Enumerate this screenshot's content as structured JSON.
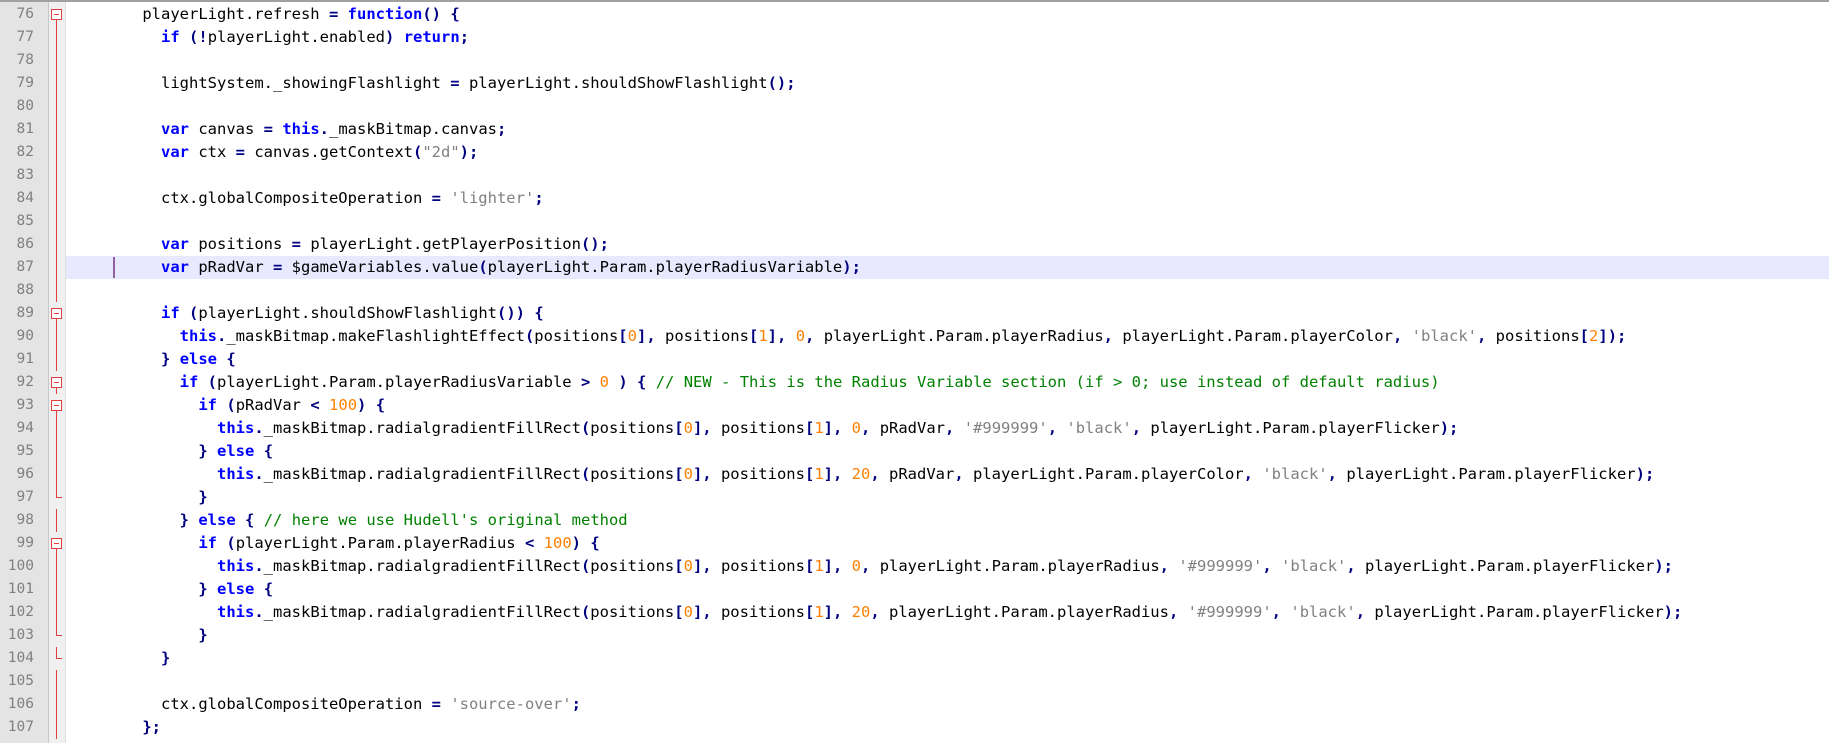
{
  "editor": {
    "current_line": 87,
    "colors": {
      "keyword": "#0000ff",
      "number": "#ff8000",
      "string": "#808080",
      "comment": "#008000",
      "operator": "#000080",
      "current_line_bg": "#e8e8ff",
      "gutter_bg": "#e4e4e4",
      "fold_marker": "#e04040"
    },
    "lines": [
      {
        "n": "76",
        "fold": "open",
        "indent": 2,
        "tokens": [
          [
            "id",
            "playerLight.refresh "
          ],
          [
            "op",
            "="
          ],
          [
            "id",
            " "
          ],
          [
            "kw",
            "function"
          ],
          [
            "op",
            "()"
          ],
          [
            "id",
            " "
          ],
          [
            "op",
            "{"
          ]
        ]
      },
      {
        "n": "77",
        "fold": "line",
        "indent": 3,
        "tokens": [
          [
            "kw",
            "if"
          ],
          [
            "id",
            " "
          ],
          [
            "op",
            "(!"
          ],
          [
            "id",
            "playerLight.enabled"
          ],
          [
            "op",
            ")"
          ],
          [
            "id",
            " "
          ],
          [
            "kw",
            "return"
          ],
          [
            "op",
            ";"
          ]
        ]
      },
      {
        "n": "78",
        "fold": "line",
        "indent": 0,
        "tokens": []
      },
      {
        "n": "79",
        "fold": "line",
        "indent": 3,
        "tokens": [
          [
            "id",
            "lightSystem._showingFlashlight "
          ],
          [
            "op",
            "="
          ],
          [
            "id",
            " playerLight.shouldShowFlashlight"
          ],
          [
            "op",
            "();"
          ]
        ]
      },
      {
        "n": "80",
        "fold": "line",
        "indent": 0,
        "tokens": []
      },
      {
        "n": "81",
        "fold": "line",
        "indent": 3,
        "tokens": [
          [
            "kw",
            "var"
          ],
          [
            "id",
            " canvas "
          ],
          [
            "op",
            "="
          ],
          [
            "id",
            " "
          ],
          [
            "kw",
            "this"
          ],
          [
            "op",
            "."
          ],
          [
            "id",
            "_maskBitmap.canvas"
          ],
          [
            "op",
            ";"
          ]
        ]
      },
      {
        "n": "82",
        "fold": "line",
        "indent": 3,
        "tokens": [
          [
            "kw",
            "var"
          ],
          [
            "id",
            " ctx "
          ],
          [
            "op",
            "="
          ],
          [
            "id",
            " canvas.getContext"
          ],
          [
            "op",
            "("
          ],
          [
            "str",
            "\"2d\""
          ],
          [
            "op",
            ");"
          ]
        ]
      },
      {
        "n": "83",
        "fold": "line",
        "indent": 0,
        "tokens": []
      },
      {
        "n": "84",
        "fold": "line",
        "indent": 3,
        "tokens": [
          [
            "id",
            "ctx.globalCompositeOperation "
          ],
          [
            "op",
            "="
          ],
          [
            "id",
            " "
          ],
          [
            "str",
            "'lighter'"
          ],
          [
            "op",
            ";"
          ]
        ]
      },
      {
        "n": "85",
        "fold": "line",
        "indent": 0,
        "tokens": []
      },
      {
        "n": "86",
        "fold": "line",
        "indent": 3,
        "tokens": [
          [
            "kw",
            "var"
          ],
          [
            "id",
            " positions "
          ],
          [
            "op",
            "="
          ],
          [
            "id",
            " playerLight.getPlayerPosition"
          ],
          [
            "op",
            "();"
          ]
        ]
      },
      {
        "n": "87",
        "fold": "line",
        "indent": 3,
        "tokens": [
          [
            "kw",
            "var"
          ],
          [
            "id",
            " pRadVar "
          ],
          [
            "op",
            "="
          ],
          [
            "id",
            " $gameVariables.value"
          ],
          [
            "op",
            "("
          ],
          [
            "id",
            "playerLight.Param.playerRadiusVariable"
          ],
          [
            "op",
            ");"
          ]
        ]
      },
      {
        "n": "88",
        "fold": "line",
        "indent": 0,
        "tokens": []
      },
      {
        "n": "89",
        "fold": "open",
        "indent": 3,
        "tokens": [
          [
            "kw",
            "if"
          ],
          [
            "id",
            " "
          ],
          [
            "op",
            "("
          ],
          [
            "id",
            "playerLight.shouldShowFlashlight"
          ],
          [
            "op",
            "())"
          ],
          [
            "id",
            " "
          ],
          [
            "op",
            "{"
          ]
        ]
      },
      {
        "n": "90",
        "fold": "line",
        "indent": 4,
        "tokens": [
          [
            "kw",
            "this"
          ],
          [
            "op",
            "."
          ],
          [
            "id",
            "_maskBitmap.makeFlashlightEffect"
          ],
          [
            "op",
            "("
          ],
          [
            "id",
            "positions"
          ],
          [
            "op",
            "["
          ],
          [
            "num",
            "0"
          ],
          [
            "op",
            "],"
          ],
          [
            "id",
            " positions"
          ],
          [
            "op",
            "["
          ],
          [
            "num",
            "1"
          ],
          [
            "op",
            "],"
          ],
          [
            "id",
            " "
          ],
          [
            "num",
            "0"
          ],
          [
            "op",
            ","
          ],
          [
            "id",
            " playerLight.Param.playerRadius"
          ],
          [
            "op",
            ","
          ],
          [
            "id",
            " playerLight.Param.playerColor"
          ],
          [
            "op",
            ","
          ],
          [
            "id",
            " "
          ],
          [
            "str",
            "'black'"
          ],
          [
            "op",
            ","
          ],
          [
            "id",
            " positions"
          ],
          [
            "op",
            "["
          ],
          [
            "num",
            "2"
          ],
          [
            "op",
            "]);"
          ]
        ]
      },
      {
        "n": "91",
        "fold": "line",
        "indent": 3,
        "tokens": [
          [
            "op",
            "}"
          ],
          [
            "id",
            " "
          ],
          [
            "kw",
            "else"
          ],
          [
            "id",
            " "
          ],
          [
            "op",
            "{"
          ]
        ]
      },
      {
        "n": "92",
        "fold": "open",
        "indent": 4,
        "tokens": [
          [
            "kw",
            "if"
          ],
          [
            "id",
            " "
          ],
          [
            "op",
            "("
          ],
          [
            "id",
            "playerLight.Param.playerRadiusVariable "
          ],
          [
            "op",
            ">"
          ],
          [
            "id",
            " "
          ],
          [
            "num",
            "0"
          ],
          [
            "id",
            " "
          ],
          [
            "op",
            ")"
          ],
          [
            "id",
            " "
          ],
          [
            "op",
            "{"
          ],
          [
            "id",
            " "
          ],
          [
            "cmt",
            "// NEW - This is the Radius Variable section (if > 0; use instead of default radius)"
          ]
        ]
      },
      {
        "n": "93",
        "fold": "open",
        "indent": 5,
        "tokens": [
          [
            "kw",
            "if"
          ],
          [
            "id",
            " "
          ],
          [
            "op",
            "("
          ],
          [
            "id",
            "pRadVar "
          ],
          [
            "op",
            "<"
          ],
          [
            "id",
            " "
          ],
          [
            "num",
            "100"
          ],
          [
            "op",
            ")"
          ],
          [
            "id",
            " "
          ],
          [
            "op",
            "{"
          ]
        ]
      },
      {
        "n": "94",
        "fold": "line",
        "indent": 6,
        "tokens": [
          [
            "kw",
            "this"
          ],
          [
            "op",
            "."
          ],
          [
            "id",
            "_maskBitmap.radialgradientFillRect"
          ],
          [
            "op",
            "("
          ],
          [
            "id",
            "positions"
          ],
          [
            "op",
            "["
          ],
          [
            "num",
            "0"
          ],
          [
            "op",
            "],"
          ],
          [
            "id",
            " positions"
          ],
          [
            "op",
            "["
          ],
          [
            "num",
            "1"
          ],
          [
            "op",
            "],"
          ],
          [
            "id",
            " "
          ],
          [
            "num",
            "0"
          ],
          [
            "op",
            ","
          ],
          [
            "id",
            " pRadVar"
          ],
          [
            "op",
            ","
          ],
          [
            "id",
            " "
          ],
          [
            "str",
            "'#999999'"
          ],
          [
            "op",
            ","
          ],
          [
            "id",
            " "
          ],
          [
            "str",
            "'black'"
          ],
          [
            "op",
            ","
          ],
          [
            "id",
            " playerLight.Param.playerFlicker"
          ],
          [
            "op",
            ");"
          ]
        ]
      },
      {
        "n": "95",
        "fold": "line",
        "indent": 5,
        "tokens": [
          [
            "op",
            "}"
          ],
          [
            "id",
            " "
          ],
          [
            "kw",
            "else"
          ],
          [
            "id",
            " "
          ],
          [
            "op",
            "{"
          ]
        ]
      },
      {
        "n": "96",
        "fold": "line",
        "indent": 6,
        "tokens": [
          [
            "kw",
            "this"
          ],
          [
            "op",
            "."
          ],
          [
            "id",
            "_maskBitmap.radialgradientFillRect"
          ],
          [
            "op",
            "("
          ],
          [
            "id",
            "positions"
          ],
          [
            "op",
            "["
          ],
          [
            "num",
            "0"
          ],
          [
            "op",
            "],"
          ],
          [
            "id",
            " positions"
          ],
          [
            "op",
            "["
          ],
          [
            "num",
            "1"
          ],
          [
            "op",
            "],"
          ],
          [
            "id",
            " "
          ],
          [
            "num",
            "20"
          ],
          [
            "op",
            ","
          ],
          [
            "id",
            " pRadVar"
          ],
          [
            "op",
            ","
          ],
          [
            "id",
            " playerLight.Param.playerColor"
          ],
          [
            "op",
            ","
          ],
          [
            "id",
            " "
          ],
          [
            "str",
            "'black'"
          ],
          [
            "op",
            ","
          ],
          [
            "id",
            " playerLight.Param.playerFlicker"
          ],
          [
            "op",
            ");"
          ]
        ]
      },
      {
        "n": "97",
        "fold": "end",
        "indent": 5,
        "tokens": [
          [
            "op",
            "}"
          ]
        ]
      },
      {
        "n": "98",
        "fold": "line",
        "indent": 4,
        "tokens": [
          [
            "op",
            "}"
          ],
          [
            "id",
            " "
          ],
          [
            "kw",
            "else"
          ],
          [
            "id",
            " "
          ],
          [
            "op",
            "{"
          ],
          [
            "id",
            " "
          ],
          [
            "cmt",
            "// here we use Hudell's original method"
          ]
        ]
      },
      {
        "n": "99",
        "fold": "open",
        "indent": 5,
        "tokens": [
          [
            "kw",
            "if"
          ],
          [
            "id",
            " "
          ],
          [
            "op",
            "("
          ],
          [
            "id",
            "playerLight.Param.playerRadius "
          ],
          [
            "op",
            "<"
          ],
          [
            "id",
            " "
          ],
          [
            "num",
            "100"
          ],
          [
            "op",
            ")"
          ],
          [
            "id",
            " "
          ],
          [
            "op",
            "{"
          ]
        ]
      },
      {
        "n": "100",
        "fold": "line",
        "indent": 6,
        "tokens": [
          [
            "kw",
            "this"
          ],
          [
            "op",
            "."
          ],
          [
            "id",
            "_maskBitmap.radialgradientFillRect"
          ],
          [
            "op",
            "("
          ],
          [
            "id",
            "positions"
          ],
          [
            "op",
            "["
          ],
          [
            "num",
            "0"
          ],
          [
            "op",
            "],"
          ],
          [
            "id",
            " positions"
          ],
          [
            "op",
            "["
          ],
          [
            "num",
            "1"
          ],
          [
            "op",
            "],"
          ],
          [
            "id",
            " "
          ],
          [
            "num",
            "0"
          ],
          [
            "op",
            ","
          ],
          [
            "id",
            " playerLight.Param.playerRadius"
          ],
          [
            "op",
            ","
          ],
          [
            "id",
            " "
          ],
          [
            "str",
            "'#999999'"
          ],
          [
            "op",
            ","
          ],
          [
            "id",
            " "
          ],
          [
            "str",
            "'black'"
          ],
          [
            "op",
            ","
          ],
          [
            "id",
            " playerLight.Param.playerFlicker"
          ],
          [
            "op",
            ");"
          ]
        ]
      },
      {
        "n": "101",
        "fold": "line",
        "indent": 5,
        "tokens": [
          [
            "op",
            "}"
          ],
          [
            "id",
            " "
          ],
          [
            "kw",
            "else"
          ],
          [
            "id",
            " "
          ],
          [
            "op",
            "{"
          ]
        ]
      },
      {
        "n": "102",
        "fold": "line",
        "indent": 6,
        "tokens": [
          [
            "kw",
            "this"
          ],
          [
            "op",
            "."
          ],
          [
            "id",
            "_maskBitmap.radialgradientFillRect"
          ],
          [
            "op",
            "("
          ],
          [
            "id",
            "positions"
          ],
          [
            "op",
            "["
          ],
          [
            "num",
            "0"
          ],
          [
            "op",
            "],"
          ],
          [
            "id",
            " positions"
          ],
          [
            "op",
            "["
          ],
          [
            "num",
            "1"
          ],
          [
            "op",
            "],"
          ],
          [
            "id",
            " "
          ],
          [
            "num",
            "20"
          ],
          [
            "op",
            ","
          ],
          [
            "id",
            " playerLight.Param.playerRadius"
          ],
          [
            "op",
            ","
          ],
          [
            "id",
            " "
          ],
          [
            "str",
            "'#999999'"
          ],
          [
            "op",
            ","
          ],
          [
            "id",
            " "
          ],
          [
            "str",
            "'black'"
          ],
          [
            "op",
            ","
          ],
          [
            "id",
            " playerLight.Param.playerFlicker"
          ],
          [
            "op",
            ");"
          ]
        ]
      },
      {
        "n": "103",
        "fold": "end",
        "indent": 5,
        "tokens": [
          [
            "op",
            "}"
          ]
        ]
      },
      {
        "n": "104",
        "fold": "end",
        "indent": 3,
        "tokens": [
          [
            "op",
            "}"
          ]
        ]
      },
      {
        "n": "105",
        "fold": "line",
        "indent": 0,
        "tokens": []
      },
      {
        "n": "106",
        "fold": "line",
        "indent": 3,
        "tokens": [
          [
            "id",
            "ctx.globalCompositeOperation "
          ],
          [
            "op",
            "="
          ],
          [
            "id",
            " "
          ],
          [
            "str",
            "'source-over'"
          ],
          [
            "op",
            ";"
          ]
        ]
      },
      {
        "n": "107",
        "fold": "line",
        "indent": 2,
        "tokens": [
          [
            "op",
            "};"
          ]
        ]
      }
    ]
  }
}
